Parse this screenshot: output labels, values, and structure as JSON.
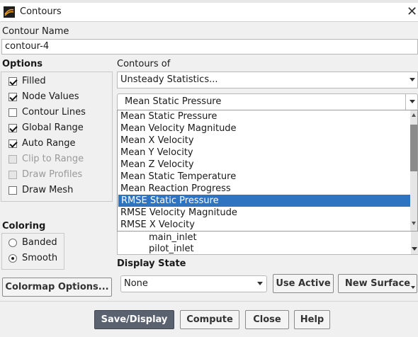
{
  "window": {
    "title": "Contours"
  },
  "contour_name": {
    "label": "Contour Name",
    "value": "contour-4"
  },
  "options": {
    "label": "Options",
    "items": [
      {
        "label": "Filled",
        "checked": true,
        "enabled": true
      },
      {
        "label": "Node Values",
        "checked": true,
        "enabled": true
      },
      {
        "label": "Contour Lines",
        "checked": false,
        "enabled": true
      },
      {
        "label": "Global Range",
        "checked": true,
        "enabled": true
      },
      {
        "label": "Auto Range",
        "checked": true,
        "enabled": true
      },
      {
        "label": "Clip to Range",
        "checked": false,
        "enabled": false
      },
      {
        "label": "Draw Profiles",
        "checked": false,
        "enabled": false
      },
      {
        "label": "Draw Mesh",
        "checked": false,
        "enabled": true
      }
    ]
  },
  "coloring": {
    "label": "Coloring",
    "options": [
      {
        "label": "Banded",
        "selected": false
      },
      {
        "label": "Smooth",
        "selected": true
      }
    ]
  },
  "colormap_button": "Colormap Options...",
  "contours_of": {
    "label": "Contours of",
    "category": "Unsteady Statistics...",
    "variable": "Mean Static Pressure",
    "dropdown_items": [
      "Mean Static Pressure",
      "Mean Velocity Magnitude",
      "Mean X Velocity",
      "Mean Y Velocity",
      "Mean Z Velocity",
      "Mean Static Temperature",
      "Mean Reaction Progress",
      "RMSE Static Pressure",
      "RMSE Velocity Magnitude",
      "RMSE X Velocity"
    ],
    "highlighted": "RMSE Static Pressure"
  },
  "surfaces_list": [
    "main_inlet",
    "pilot_inlet"
  ],
  "display_state": {
    "label": "Display State",
    "value": "None",
    "use_active": "Use Active",
    "new_surface": "New Surface"
  },
  "footer": {
    "save_display": "Save/Display",
    "compute": "Compute",
    "close": "Close",
    "help": "Help"
  },
  "colors": {
    "accent": "#2f74c0",
    "primary_button": "#5a6270"
  }
}
